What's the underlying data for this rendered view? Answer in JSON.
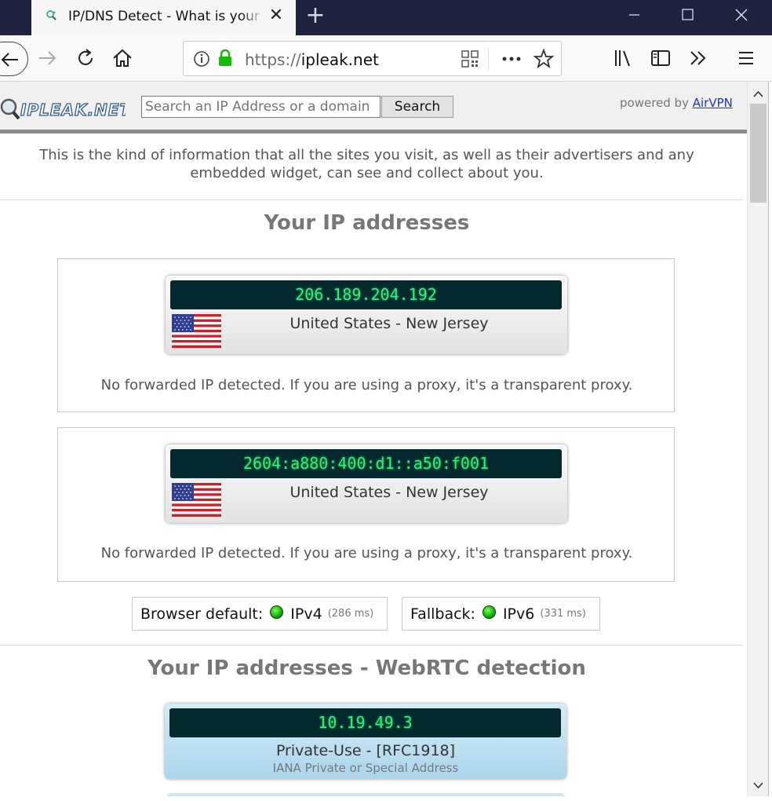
{
  "tab": {
    "title": "IP/DNS Detect - What is your IP"
  },
  "window": {
    "minimize": "—",
    "maximize": "☐",
    "close": "✕"
  },
  "nav": {
    "url_protocol": "https://",
    "url_host": "ipleak.net"
  },
  "site": {
    "logo_text": "IPLEAK.NET",
    "search_placeholder": "Search an IP Address or a domain",
    "search_button": "Search",
    "powered_by": "powered by",
    "powered_link": "AirVPN"
  },
  "intro": "This is the kind of information that all the sites you visit, as well as their advertisers and any embedded widget, can see and collect about you.",
  "ip_section": {
    "title": "Your IP addresses",
    "entries": [
      {
        "ip": "206.189.204.192",
        "location": "United States - New Jersey",
        "note": "No forwarded IP detected. If you are using a proxy, it's a transparent proxy."
      },
      {
        "ip": "2604:a880:400:d1::a50:f001",
        "location": "United States - New Jersey",
        "note": "No forwarded IP detected. If you are using a proxy, it's a transparent proxy."
      }
    ],
    "browser_default_label": "Browser default:",
    "browser_default_proto": "IPv4",
    "browser_default_ms": "(286 ms)",
    "fallback_label": "Fallback:",
    "fallback_proto": "IPv6",
    "fallback_ms": "(331 ms)"
  },
  "webrtc_section": {
    "title": "Your IP addresses - WebRTC detection",
    "entries": [
      {
        "ip": "10.19.49.3",
        "type": "Private-Use - [RFC1918]",
        "sub": "IANA Private or Special Address"
      }
    ]
  },
  "colors": {
    "ip_display_bg": "#03282e",
    "ip_digits": "#2ef07a",
    "titlebar": "#202340",
    "link": "#1a35c8"
  }
}
